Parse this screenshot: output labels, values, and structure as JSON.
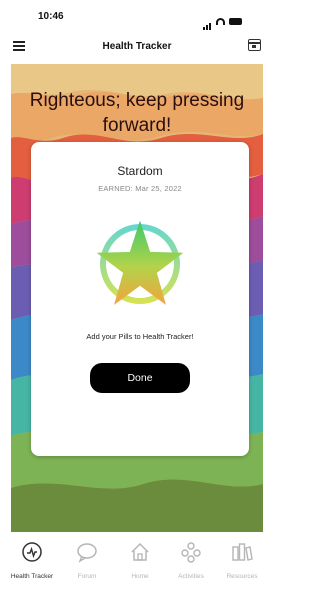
{
  "status_bar": {
    "time": "10:46"
  },
  "nav": {
    "title": "Health Tracker",
    "menu_icon": "hamburger-menu-icon",
    "right_icon": "calendar-icon"
  },
  "hero": {
    "message": "Righteous; keep pressing forward!"
  },
  "modal": {
    "title": "Stardom",
    "earned": "EARNED: Mar 25, 2022",
    "badge_icon": "star-badge-icon",
    "message": "Add your Pills to Health Tracker!",
    "done_label": "Done"
  },
  "tabs": [
    {
      "label": "Health Tracker",
      "icon": "health-tracker-icon",
      "active": true
    },
    {
      "label": "Forum",
      "icon": "chat-bubble-icon",
      "active": false
    },
    {
      "label": "Home",
      "icon": "home-icon",
      "active": false
    },
    {
      "label": "Activities",
      "icon": "activities-icon",
      "active": false
    },
    {
      "label": "Resources",
      "icon": "resources-icon",
      "active": false
    }
  ],
  "colors": {
    "active_tab": "#333333",
    "inactive_tab": "#b5b5b5",
    "button": "#000000",
    "hero_text": "#2a0f0f"
  }
}
